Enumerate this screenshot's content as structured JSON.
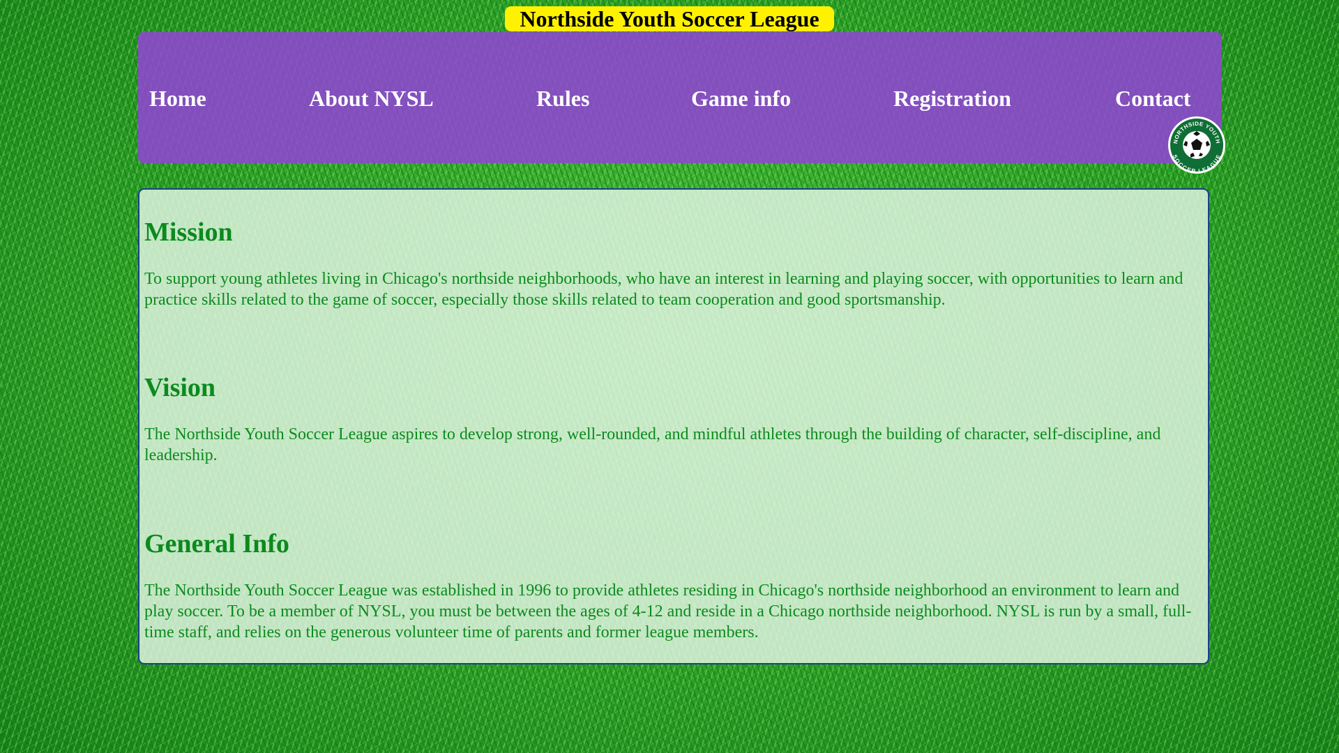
{
  "header": {
    "title": "Northside Youth Soccer League"
  },
  "nav": {
    "items": [
      {
        "label": "Home"
      },
      {
        "label": "About NYSL"
      },
      {
        "label": "Rules"
      },
      {
        "label": "Game info"
      },
      {
        "label": "Registration"
      },
      {
        "label": "Contact"
      }
    ]
  },
  "logo": {
    "text_top": "NORTHSIDE YOUTH",
    "text_bottom": "SOCCER LEAGUE",
    "icon": "soccer-ball-icon"
  },
  "main": {
    "sections": [
      {
        "heading": "Mission",
        "text": "To support young athletes living in Chicago's northside neighborhoods, who have an interest in learning and playing soccer, with opportunities to learn and practice skills related to the game of soccer, especially those skills related to team cooperation and good sportsmanship."
      },
      {
        "heading": "Vision",
        "text": "The Northside Youth Soccer League aspires to develop strong, well-rounded, and mindful athletes through the building of character, self-discipline, and leadership."
      },
      {
        "heading": "General Info",
        "text": "The Northside Youth Soccer League was established in 1996 to provide athletes residing in Chicago's northside neighborhood an environment to learn and play soccer. To be a member of NYSL, you must be between the ages of 4-12 and reside in a Chicago northside neighborhood. NYSL is run by a small, full-time staff, and relies on the generous volunteer time of parents and former league members."
      }
    ]
  },
  "colors": {
    "title_bg": "#fff200",
    "nav_bg": "#9244d6",
    "nav_text": "#ffffff",
    "content_text": "#0b8a1e",
    "content_border": "#1a3f8a",
    "grass": "#2fae2c"
  }
}
